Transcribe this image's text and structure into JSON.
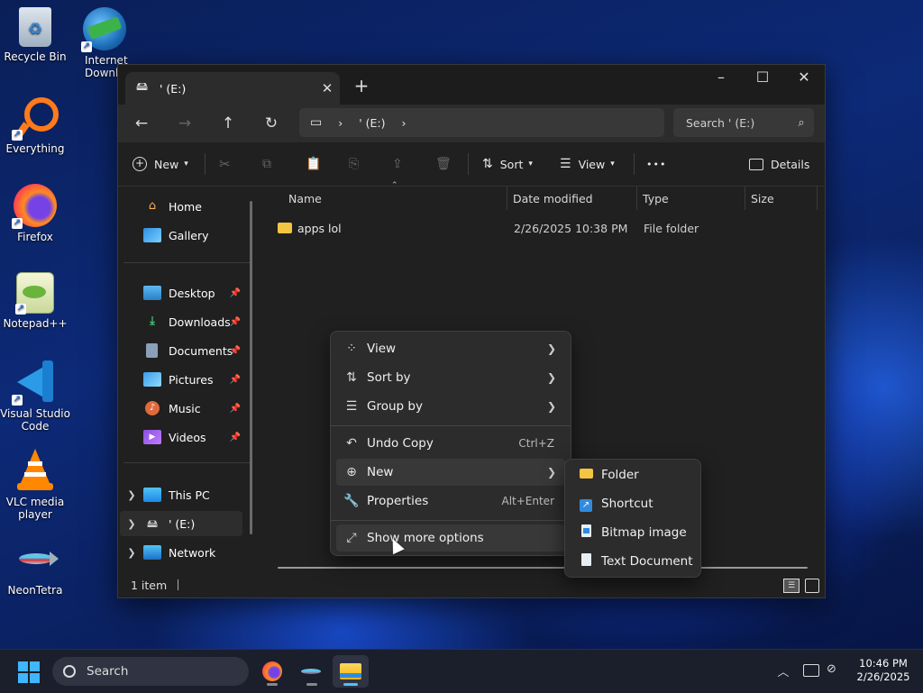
{
  "desktop": {
    "icons": [
      {
        "label": "Recycle Bin",
        "icon": "recycle-bin-icon"
      },
      {
        "label": "Internet Downlo",
        "icon": "internet-download-manager-icon"
      },
      {
        "label": "Everything",
        "icon": "everything-search-icon"
      },
      {
        "label": "Firefox",
        "icon": "firefox-icon"
      },
      {
        "label": "Notepad++",
        "icon": "notepad-plus-plus-icon"
      },
      {
        "label": "Visual Studio Code",
        "icon": "vscode-icon"
      },
      {
        "label": "VLC media player",
        "icon": "vlc-icon"
      },
      {
        "label": "NeonTetra",
        "icon": "neon-tetra-fish-icon"
      }
    ]
  },
  "explorer": {
    "tab_title": "' (E:)",
    "window_controls": {
      "minimize": "–",
      "maximize": "☐",
      "close": "✕"
    },
    "address": {
      "computer_icon": "▭",
      "sep1": "›",
      "drive": "' (E:)",
      "sep2": "›"
    },
    "search_placeholder": "Search ' (E:)",
    "toolbar": {
      "new_label": "New",
      "sort_label": "Sort",
      "view_label": "View",
      "more_label": "•••",
      "details_label": "Details"
    },
    "nav": {
      "home": "Home",
      "gallery": "Gallery",
      "desktop": "Desktop",
      "downloads": "Downloads",
      "documents": "Documents",
      "pictures": "Pictures",
      "music": "Music",
      "videos": "Videos",
      "this_pc": "This PC",
      "drive_e": "' (E:)",
      "network": "Network"
    },
    "columns": {
      "name": "Name",
      "date": "Date modified",
      "type": "Type",
      "size": "Size"
    },
    "rows": [
      {
        "name": "apps lol",
        "date": "2/26/2025 10:38 PM",
        "type": "File folder",
        "size": ""
      }
    ],
    "status": "1 item"
  },
  "context_menu": {
    "view": "View",
    "sort_by": "Sort by",
    "group_by": "Group by",
    "undo_copy": "Undo Copy",
    "undo_shortcut": "Ctrl+Z",
    "new": "New",
    "properties": "Properties",
    "properties_shortcut": "Alt+Enter",
    "show_more": "Show more options"
  },
  "new_submenu": {
    "folder": "Folder",
    "shortcut": "Shortcut",
    "bitmap": "Bitmap image",
    "text_doc": "Text Document"
  },
  "taskbar": {
    "search_placeholder": "Search",
    "time": "10:46 PM",
    "date": "2/26/2025"
  },
  "colors": {
    "accent": "#4cc2ff",
    "folder": "#f4c542",
    "window_bg": "#202020",
    "menu_bg": "#2c2c2c"
  }
}
